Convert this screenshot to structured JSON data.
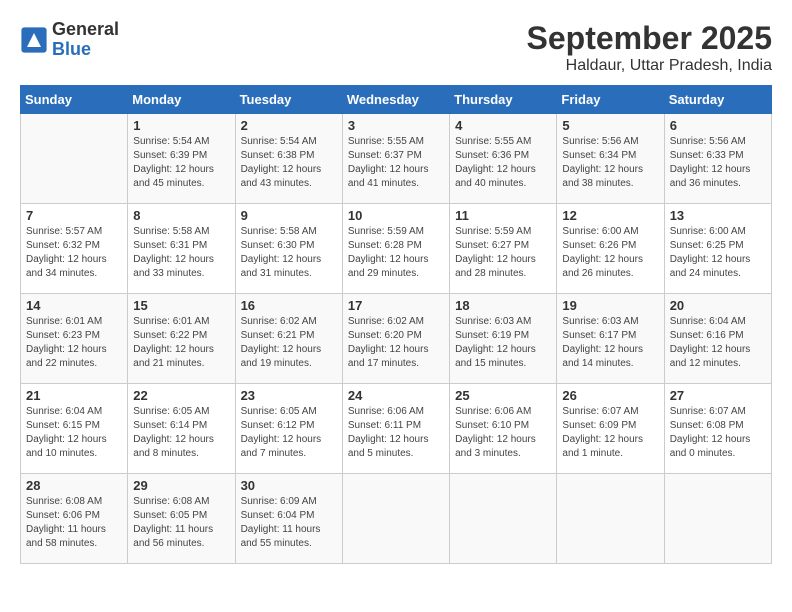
{
  "logo": {
    "text_general": "General",
    "text_blue": "Blue"
  },
  "header": {
    "title": "September 2025",
    "subtitle": "Haldaur, Uttar Pradesh, India"
  },
  "weekdays": [
    "Sunday",
    "Monday",
    "Tuesday",
    "Wednesday",
    "Thursday",
    "Friday",
    "Saturday"
  ],
  "weeks": [
    [
      {
        "day": "",
        "info": ""
      },
      {
        "day": "1",
        "info": "Sunrise: 5:54 AM\nSunset: 6:39 PM\nDaylight: 12 hours\nand 45 minutes."
      },
      {
        "day": "2",
        "info": "Sunrise: 5:54 AM\nSunset: 6:38 PM\nDaylight: 12 hours\nand 43 minutes."
      },
      {
        "day": "3",
        "info": "Sunrise: 5:55 AM\nSunset: 6:37 PM\nDaylight: 12 hours\nand 41 minutes."
      },
      {
        "day": "4",
        "info": "Sunrise: 5:55 AM\nSunset: 6:36 PM\nDaylight: 12 hours\nand 40 minutes."
      },
      {
        "day": "5",
        "info": "Sunrise: 5:56 AM\nSunset: 6:34 PM\nDaylight: 12 hours\nand 38 minutes."
      },
      {
        "day": "6",
        "info": "Sunrise: 5:56 AM\nSunset: 6:33 PM\nDaylight: 12 hours\nand 36 minutes."
      }
    ],
    [
      {
        "day": "7",
        "info": "Sunrise: 5:57 AM\nSunset: 6:32 PM\nDaylight: 12 hours\nand 34 minutes."
      },
      {
        "day": "8",
        "info": "Sunrise: 5:58 AM\nSunset: 6:31 PM\nDaylight: 12 hours\nand 33 minutes."
      },
      {
        "day": "9",
        "info": "Sunrise: 5:58 AM\nSunset: 6:30 PM\nDaylight: 12 hours\nand 31 minutes."
      },
      {
        "day": "10",
        "info": "Sunrise: 5:59 AM\nSunset: 6:28 PM\nDaylight: 12 hours\nand 29 minutes."
      },
      {
        "day": "11",
        "info": "Sunrise: 5:59 AM\nSunset: 6:27 PM\nDaylight: 12 hours\nand 28 minutes."
      },
      {
        "day": "12",
        "info": "Sunrise: 6:00 AM\nSunset: 6:26 PM\nDaylight: 12 hours\nand 26 minutes."
      },
      {
        "day": "13",
        "info": "Sunrise: 6:00 AM\nSunset: 6:25 PM\nDaylight: 12 hours\nand 24 minutes."
      }
    ],
    [
      {
        "day": "14",
        "info": "Sunrise: 6:01 AM\nSunset: 6:23 PM\nDaylight: 12 hours\nand 22 minutes."
      },
      {
        "day": "15",
        "info": "Sunrise: 6:01 AM\nSunset: 6:22 PM\nDaylight: 12 hours\nand 21 minutes."
      },
      {
        "day": "16",
        "info": "Sunrise: 6:02 AM\nSunset: 6:21 PM\nDaylight: 12 hours\nand 19 minutes."
      },
      {
        "day": "17",
        "info": "Sunrise: 6:02 AM\nSunset: 6:20 PM\nDaylight: 12 hours\nand 17 minutes."
      },
      {
        "day": "18",
        "info": "Sunrise: 6:03 AM\nSunset: 6:19 PM\nDaylight: 12 hours\nand 15 minutes."
      },
      {
        "day": "19",
        "info": "Sunrise: 6:03 AM\nSunset: 6:17 PM\nDaylight: 12 hours\nand 14 minutes."
      },
      {
        "day": "20",
        "info": "Sunrise: 6:04 AM\nSunset: 6:16 PM\nDaylight: 12 hours\nand 12 minutes."
      }
    ],
    [
      {
        "day": "21",
        "info": "Sunrise: 6:04 AM\nSunset: 6:15 PM\nDaylight: 12 hours\nand 10 minutes."
      },
      {
        "day": "22",
        "info": "Sunrise: 6:05 AM\nSunset: 6:14 PM\nDaylight: 12 hours\nand 8 minutes."
      },
      {
        "day": "23",
        "info": "Sunrise: 6:05 AM\nSunset: 6:12 PM\nDaylight: 12 hours\nand 7 minutes."
      },
      {
        "day": "24",
        "info": "Sunrise: 6:06 AM\nSunset: 6:11 PM\nDaylight: 12 hours\nand 5 minutes."
      },
      {
        "day": "25",
        "info": "Sunrise: 6:06 AM\nSunset: 6:10 PM\nDaylight: 12 hours\nand 3 minutes."
      },
      {
        "day": "26",
        "info": "Sunrise: 6:07 AM\nSunset: 6:09 PM\nDaylight: 12 hours\nand 1 minute."
      },
      {
        "day": "27",
        "info": "Sunrise: 6:07 AM\nSunset: 6:08 PM\nDaylight: 12 hours\nand 0 minutes."
      }
    ],
    [
      {
        "day": "28",
        "info": "Sunrise: 6:08 AM\nSunset: 6:06 PM\nDaylight: 11 hours\nand 58 minutes."
      },
      {
        "day": "29",
        "info": "Sunrise: 6:08 AM\nSunset: 6:05 PM\nDaylight: 11 hours\nand 56 minutes."
      },
      {
        "day": "30",
        "info": "Sunrise: 6:09 AM\nSunset: 6:04 PM\nDaylight: 11 hours\nand 55 minutes."
      },
      {
        "day": "",
        "info": ""
      },
      {
        "day": "",
        "info": ""
      },
      {
        "day": "",
        "info": ""
      },
      {
        "day": "",
        "info": ""
      }
    ]
  ]
}
